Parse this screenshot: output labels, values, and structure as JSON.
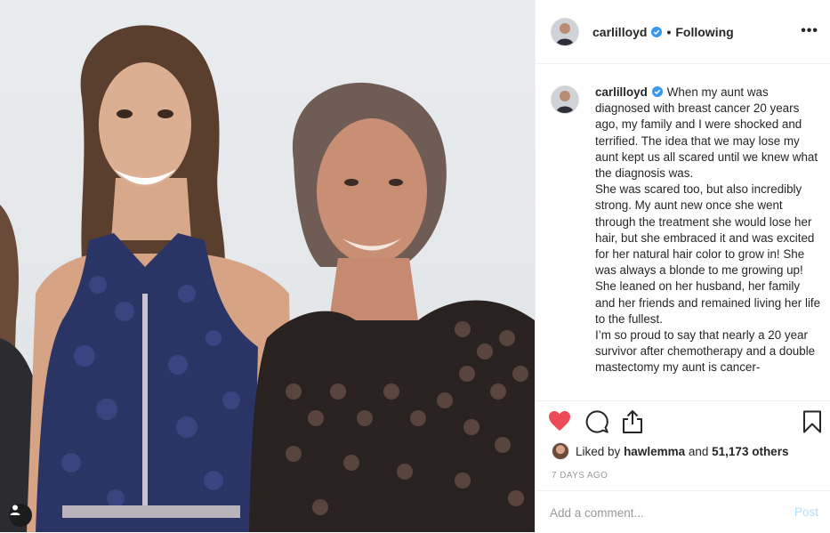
{
  "post": {
    "username": "carlilloyd",
    "follow_status": "Following",
    "separator": "•",
    "more_label": "•••",
    "caption_lines": [
      "When my aunt was diagnosed with breast cancer 20 years ago, my family and I were shocked and terrified. The idea that we may lose my aunt kept us all scared until we knew what the diagnosis was.",
      "She was scared too, but also incredibly strong. My aunt new once she went through the treatment she would lose her hair, but she embraced it and was excited for her natural hair color to grow in! She was always a blonde to me growing up! She leaned on her husband, her family and her friends and remained living her life to the fullest.",
      "I’m so proud to say that nearly a 20 year survivor after chemotherapy and a double mastectomy my aunt is cancer-"
    ],
    "likes": {
      "prefix": "Liked by",
      "liker": "hawlemma",
      "middle": "and",
      "others": "51,173 others"
    },
    "timestamp": "7 DAYS AGO",
    "comment": {
      "placeholder": "Add a comment...",
      "value": "",
      "post_label": "Post"
    }
  },
  "icons": {
    "like": "heart-icon",
    "comment": "speech-bubble-icon",
    "share": "share-upload-icon",
    "save": "bookmark-icon",
    "verified": "verified-badge-icon",
    "user_tag": "person-icon",
    "more": "more-options-icon"
  },
  "colors": {
    "like_active": "#ed4956",
    "verified": "#3897f0",
    "muted_text": "#999999",
    "post_disabled": "#b2dffc",
    "divider": "#efefef"
  }
}
